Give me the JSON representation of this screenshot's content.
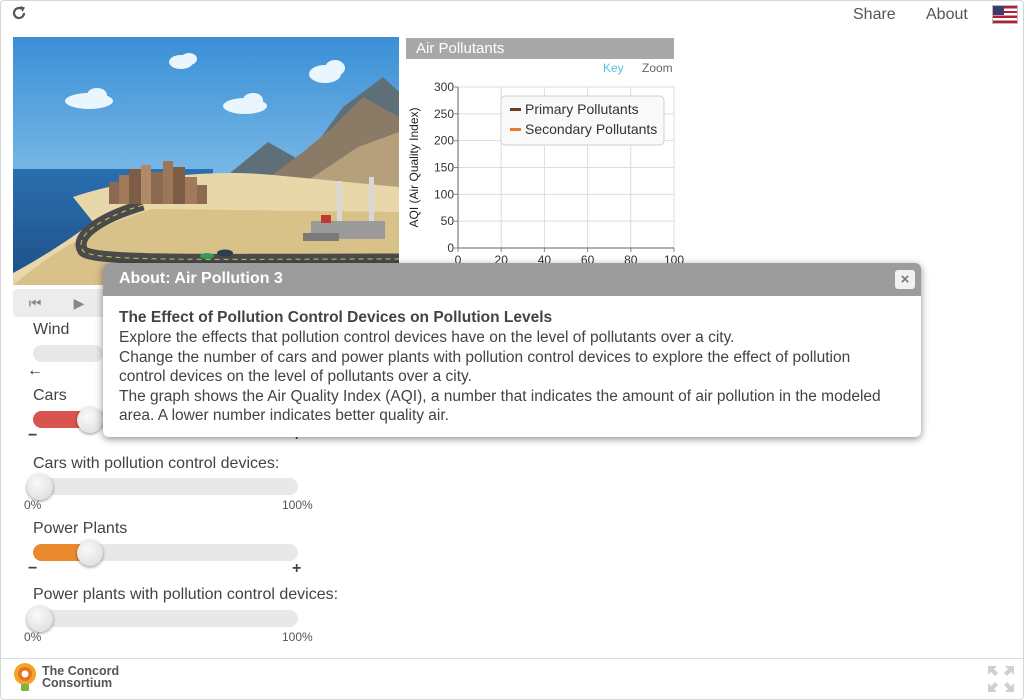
{
  "header": {
    "share_label": "Share",
    "about_label": "About"
  },
  "sliders": {
    "wind": {
      "label": "Wind",
      "value": 0.5
    },
    "cars": {
      "label": "Cars",
      "value": 0.22,
      "color": "#d9534f",
      "minus": "−",
      "plus": "+"
    },
    "cars_pcd": {
      "label": "Cars with pollution control devices:",
      "value": 0.0,
      "min_label": "0%",
      "max_label": "100%"
    },
    "power_plants": {
      "label": "Power Plants",
      "value": 0.22,
      "color": "#ea8a2e",
      "minus": "−",
      "plus": "+"
    },
    "plants_pcd": {
      "label": "Power plants with pollution control devices:",
      "value": 0.0,
      "min_label": "0%",
      "max_label": "100%"
    }
  },
  "graph": {
    "title": "Air Pollutants",
    "key_label": "Key",
    "zoom_label": "Zoom",
    "colors": {
      "primary": "#6b3e1e",
      "secondary": "#ea7c2e",
      "key_link": "#5bc0de"
    }
  },
  "chart_data": {
    "type": "line",
    "title": "Air Pollutants",
    "ylabel": "AQI (Air Quality Index)",
    "xlabel": "",
    "xlim": [
      0,
      100
    ],
    "ylim": [
      0,
      300
    ],
    "x_ticks": [
      "0",
      "20",
      "40",
      "60",
      "80",
      "100"
    ],
    "y_ticks": [
      "0",
      "50",
      "100",
      "150",
      "200",
      "250",
      "300"
    ],
    "grid": true,
    "legend_position": "top-right",
    "series": [
      {
        "name": "Primary Pollutants",
        "color": "#6b3e1e",
        "values": []
      },
      {
        "name": "Secondary Pollutants",
        "color": "#ea7c2e",
        "values": []
      }
    ]
  },
  "dialog": {
    "title": "About: Air Pollution 3",
    "close_label": "×",
    "heading": "The Effect of Pollution Control Devices on Pollution Levels",
    "paragraphs": [
      "Explore the effects that pollution control devices have on the level of pollutants over a city.",
      "Change the number of cars and power plants with pollution control devices to explore the effect of pollution control devices on the level of pollutants over a city.",
      "The graph shows the Air Quality Index (AQI), a number that indicates the amount of air pollution in the modeled area. A lower number indicates better quality air."
    ]
  },
  "footer": {
    "logo_line1": "The Concord",
    "logo_line2": "Consortium"
  }
}
